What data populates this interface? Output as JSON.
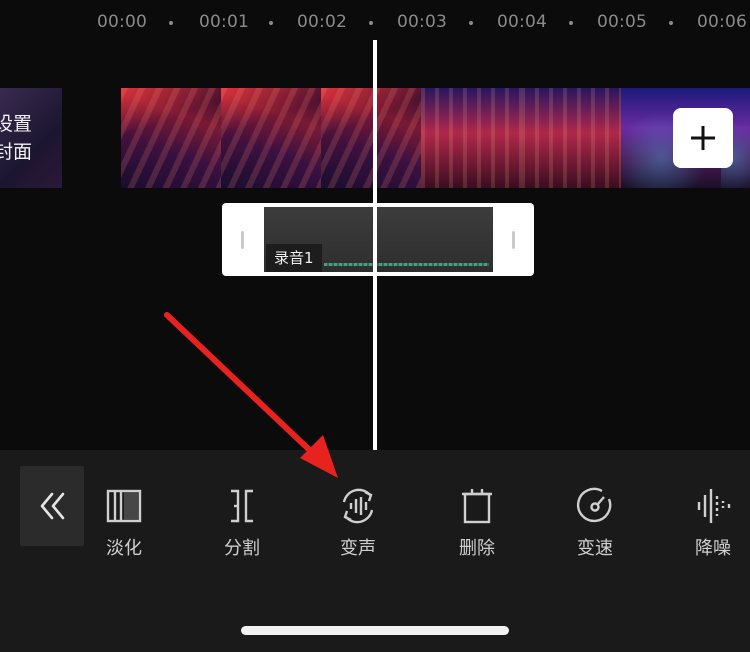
{
  "timeline": {
    "ticks": [
      "00:00",
      "00:01",
      "00:02",
      "00:03",
      "00:04",
      "00:05",
      "00:06"
    ]
  },
  "cover": {
    "line1": "设置",
    "line2": "封面"
  },
  "audio_clip": {
    "label": "录音1"
  },
  "toolbar": {
    "tools": [
      {
        "label": "淡化",
        "icon": "fade-icon"
      },
      {
        "label": "分割",
        "icon": "split-icon"
      },
      {
        "label": "变声",
        "icon": "voice-change-icon"
      },
      {
        "label": "删除",
        "icon": "delete-icon"
      },
      {
        "label": "变速",
        "icon": "speed-icon"
      },
      {
        "label": "降噪",
        "icon": "noise-reduction-icon"
      }
    ]
  },
  "colors": {
    "annotation_arrow": "#e8231f",
    "background": "#0b0b0b",
    "toolbar": "#1a1a1a",
    "waveform": "#4ea88c"
  }
}
